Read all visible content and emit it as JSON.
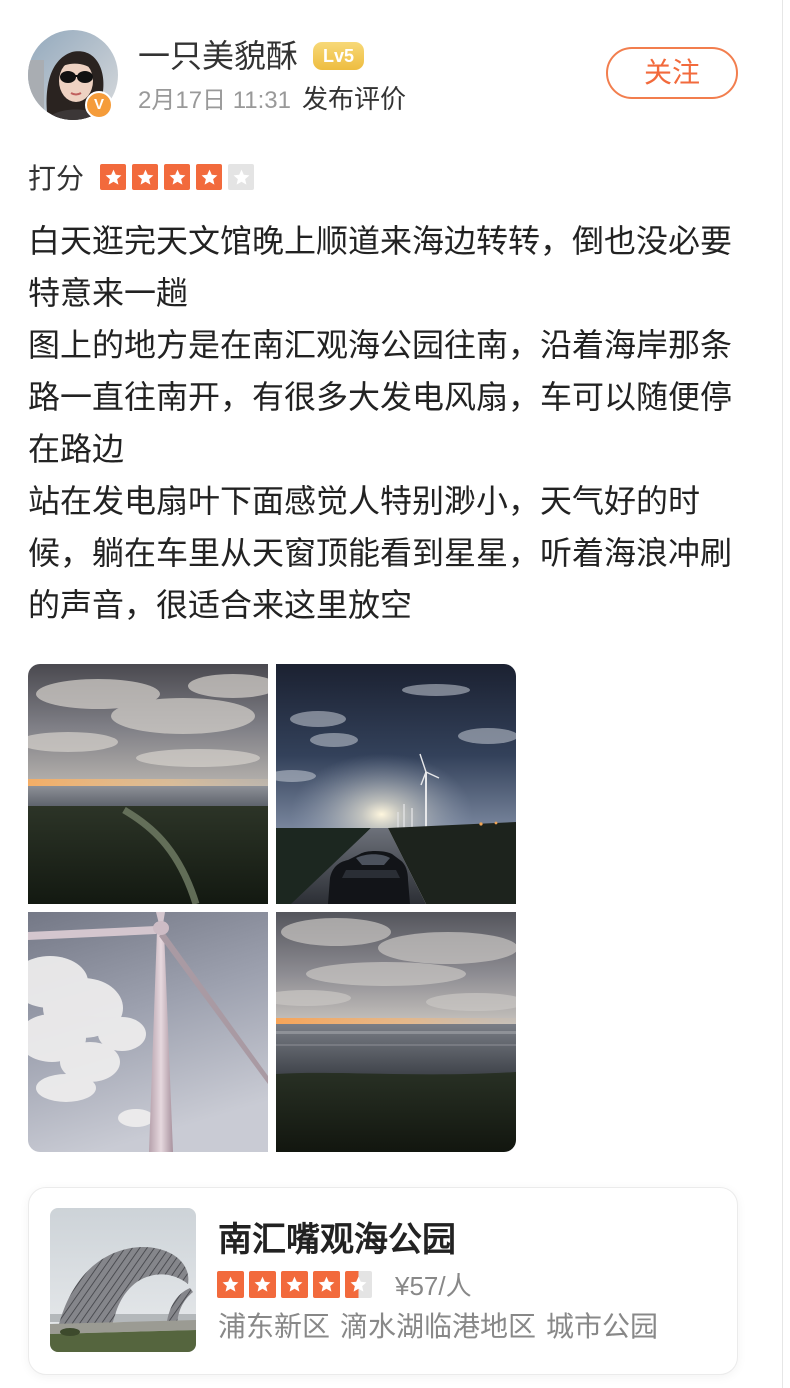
{
  "colors": {
    "accent": "#f26a3c",
    "accent_border": "#f27e4e",
    "star_filled": "#f26a3c",
    "star_empty": "#e4e4e4",
    "level_badge": "#eebd40",
    "verified_badge": "#f59c3a",
    "text_primary": "#222222",
    "text_secondary": "#999999"
  },
  "post": {
    "author": {
      "name": "一只美貌酥",
      "level": "Lv5",
      "verified_mark": "V"
    },
    "published_date": "2月17日 11:31",
    "action": "发布评价",
    "follow_label": "关注",
    "rating": {
      "label": "打分",
      "value": 4,
      "max": 5,
      "icon": "star-icon"
    },
    "paragraphs": [
      "白天逛完天文馆晚上顺道来海边转转，倒也没必要特意来一趟",
      "图上的地方是在南汇观海公园往南，沿着海岸那条路一直往南开，有很多大发电风扇，车可以随便停在路边",
      "站在发电扇叶下面感觉人特别渺小，天气好的时候，躺在车里从天窗顶能看到星星，听着海浪冲刷的声音，很适合来这里放空"
    ]
  },
  "poi_card": {
    "name": "南汇嘴观海公园",
    "rating": {
      "value": 4.5,
      "max": 5,
      "icon": "star-icon"
    },
    "price": "¥57/人",
    "tags": [
      "浦东新区",
      "滴水湖临港地区",
      "城市公园"
    ]
  }
}
